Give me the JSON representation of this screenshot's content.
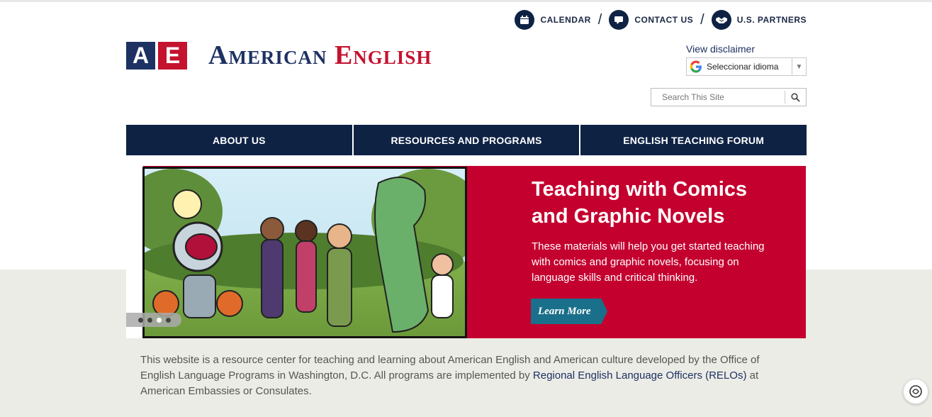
{
  "utility_nav": [
    {
      "label": "CALENDAR",
      "icon": "calendar-icon"
    },
    {
      "label": "CONTACT US",
      "icon": "chat-icon"
    },
    {
      "label": "U.S. PARTNERS",
      "icon": "handshake-icon"
    }
  ],
  "utility_separator": "/",
  "logo": {
    "letter_a": "A",
    "letter_e": "E",
    "word_1": "American",
    "word_2": "English"
  },
  "disclaimer_link": "View disclaimer",
  "language": {
    "selected": "Seleccionar idioma"
  },
  "search": {
    "placeholder": "Search This Site"
  },
  "main_nav": [
    {
      "label": "ABOUT US"
    },
    {
      "label": "RESOURCES AND PROGRAMS"
    },
    {
      "label": "ENGLISH TEACHING FORUM"
    }
  ],
  "hero": {
    "title": "Teaching with Comics and Graphic Novels",
    "description": "These materials will help you get started teaching with comics and graphic novels, focusing on language skills and critical thinking.",
    "cta": "Learn More",
    "slide_count": 4,
    "active_slide": 3
  },
  "intro": {
    "text_before": "This website is a resource center for teaching and learning about American English and American culture developed by the Office of English Language Programs in Washington, D.C. All programs are implemented by ",
    "link": "Regional English Language Officers (RELOs)",
    "text_after": " at American Embassies or Consulates."
  },
  "colors": {
    "navy": "#0e2244",
    "red": "#c4002f",
    "teal": "#1a6f8a",
    "footer_bg": "#ecece6"
  }
}
